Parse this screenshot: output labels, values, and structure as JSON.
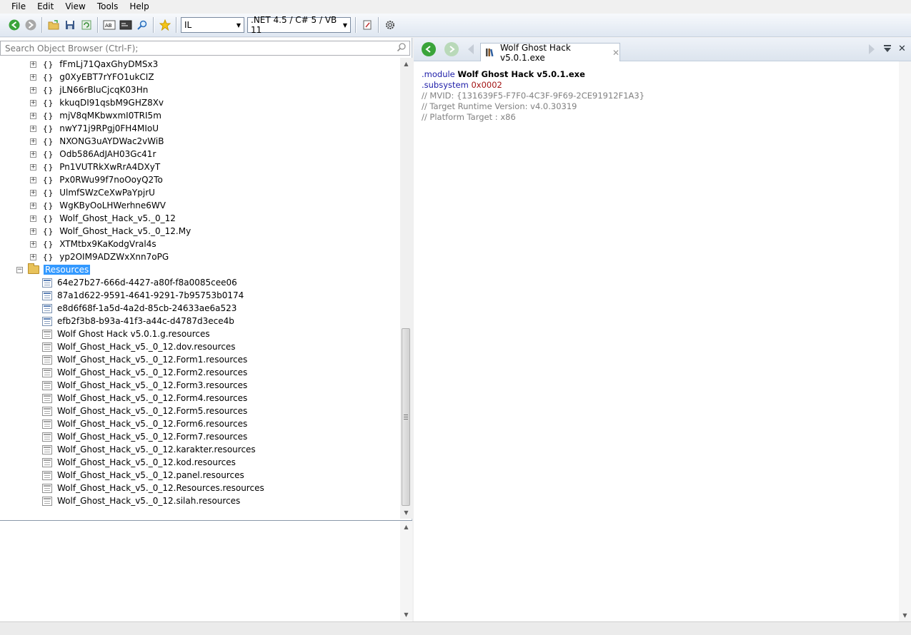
{
  "menu": [
    "File",
    "Edit",
    "View",
    "Tools",
    "Help"
  ],
  "toolbar": {
    "language": "IL",
    "framework": ".NET 4.5 / C# 5 / VB 11"
  },
  "search": {
    "placeholder": "Search Object Browser (Ctrl-F);"
  },
  "tree": {
    "namespaces": [
      "fFmLj71QaxGhyDMSx3",
      "g0XyEBT7rYFO1ukCIZ",
      "jLN66rBluCjcqK03Hn",
      "kkuqDI91qsbM9GHZ8Xv",
      "mjV8qMKbwxmI0TRI5m",
      "nwY71j9RPgj0FH4MIoU",
      "NXONG3uAYDWac2vWiB",
      "Odb586AdJAH03Gc41r",
      "Pn1VUTRkXwRrA4DXyT",
      "Px0RWu99f7noOoyQ2To",
      "UlmfSWzCeXwPaYpjrU",
      "WgKByOoLHWerhne6WV",
      "Wolf_Ghost_Hack_v5._0_12",
      "Wolf_Ghost_Hack_v5._0_12.My",
      "XTMtbx9KaKodgVral4s",
      "yp2OIM9ADZWxXnn7oPG"
    ],
    "resources_folder": "Resources",
    "resources": [
      "64e27b27-666d-4427-a80f-f8a0085cee06",
      "87a1d622-9591-4641-9291-7b95753b0174",
      "e8d6f68f-1a5d-4a2d-85cb-24633ae6a523",
      "efb2f3b8-b93a-41f3-a44c-d4787d3ece4b",
      "Wolf Ghost Hack v5.0.1.g.resources",
      "Wolf_Ghost_Hack_v5._0_12.dov.resources",
      "Wolf_Ghost_Hack_v5._0_12.Form1.resources",
      "Wolf_Ghost_Hack_v5._0_12.Form2.resources",
      "Wolf_Ghost_Hack_v5._0_12.Form3.resources",
      "Wolf_Ghost_Hack_v5._0_12.Form4.resources",
      "Wolf_Ghost_Hack_v5._0_12.Form5.resources",
      "Wolf_Ghost_Hack_v5._0_12.Form6.resources",
      "Wolf_Ghost_Hack_v5._0_12.Form7.resources",
      "Wolf_Ghost_Hack_v5._0_12.karakter.resources",
      "Wolf_Ghost_Hack_v5._0_12.kod.resources",
      "Wolf_Ghost_Hack_v5._0_12.panel.resources",
      "Wolf_Ghost_Hack_v5._0_12.Resources.resources",
      "Wolf_Ghost_Hack_v5._0_12.silah.resources"
    ]
  },
  "tab": {
    "title": "Wolf Ghost Hack v5.0.1.exe"
  },
  "code": {
    "module_kw": ".module",
    "module_name": "Wolf Ghost Hack v5.0.1.exe",
    "subsystem_kw": ".subsystem",
    "subsystem_val": "0x0002",
    "mvid": "// MVID: {131639F5-F7F0-4C3F-9F69-2CE91912F1A3}",
    "runtime": "// Target Runtime Version: v4.0.30319",
    "platform": "// Platform Target : x86"
  },
  "colors": {
    "selection": "#3399ff",
    "keyword": "#1c1ca8",
    "number": "#a31515",
    "comment": "#808080",
    "nav_green": "#3aa43a"
  }
}
